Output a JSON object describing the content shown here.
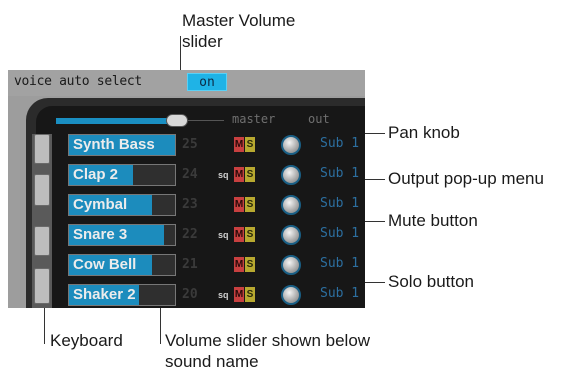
{
  "callouts": {
    "master_volume": "Master Volume slider",
    "pan_knob": "Pan knob",
    "output_menu": "Output pop-up menu",
    "mute_button": "Mute button",
    "solo_button": "Solo button",
    "keyboard": "Keyboard",
    "volume_slider": "Volume slider shown below sound name"
  },
  "panel": {
    "voice_auto_select": "voice auto select",
    "on_label": "on",
    "master_label": "master",
    "out_label": "out"
  },
  "rows": [
    {
      "name": "Synth Bass",
      "num": "25",
      "sq": "",
      "mute": "M",
      "solo": "S",
      "out": "Sub 1",
      "volume": 1.0
    },
    {
      "name": "Clap 2",
      "num": "24",
      "sq": "sq",
      "mute": "M",
      "solo": "S",
      "out": "Sub 1",
      "volume": 0.6
    },
    {
      "name": "Cymbal",
      "num": "23",
      "sq": "",
      "mute": "M",
      "solo": "S",
      "out": "Sub 1",
      "volume": 0.78
    },
    {
      "name": "Snare 3",
      "num": "22",
      "sq": "sq",
      "mute": "M",
      "solo": "S",
      "out": "Sub 1",
      "volume": 0.9
    },
    {
      "name": "Cow Bell",
      "num": "21",
      "sq": "",
      "mute": "M",
      "solo": "S",
      "out": "Sub 1",
      "volume": 0.78
    },
    {
      "name": "Shaker 2",
      "num": "20",
      "sq": "sq",
      "mute": "M",
      "solo": "S",
      "out": "Sub 1",
      "volume": 0.66
    }
  ],
  "colors": {
    "accent": "#1fb3e6",
    "mute": "#c84040",
    "solo": "#b8a930",
    "output_text": "#2c6fa0"
  }
}
